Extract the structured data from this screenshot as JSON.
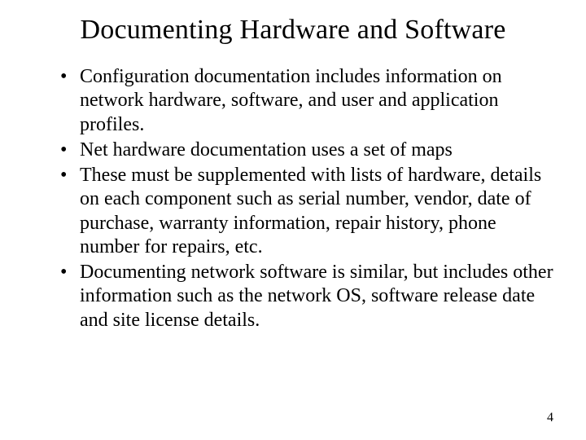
{
  "slide": {
    "title": "Documenting Hardware and Software",
    "bullets": [
      "Configuration documentation includes information on network hardware, software, and user and application profiles.",
      "Net hardware documentation uses a set of maps",
      "These must be supplemented with lists of hardware, details on each component such as serial number, vendor, date of purchase, warranty information, repair history, phone number for repairs, etc.",
      "Documenting network software is similar, but includes other information such as the network OS, software release date and site license details."
    ],
    "page_number": "4"
  }
}
